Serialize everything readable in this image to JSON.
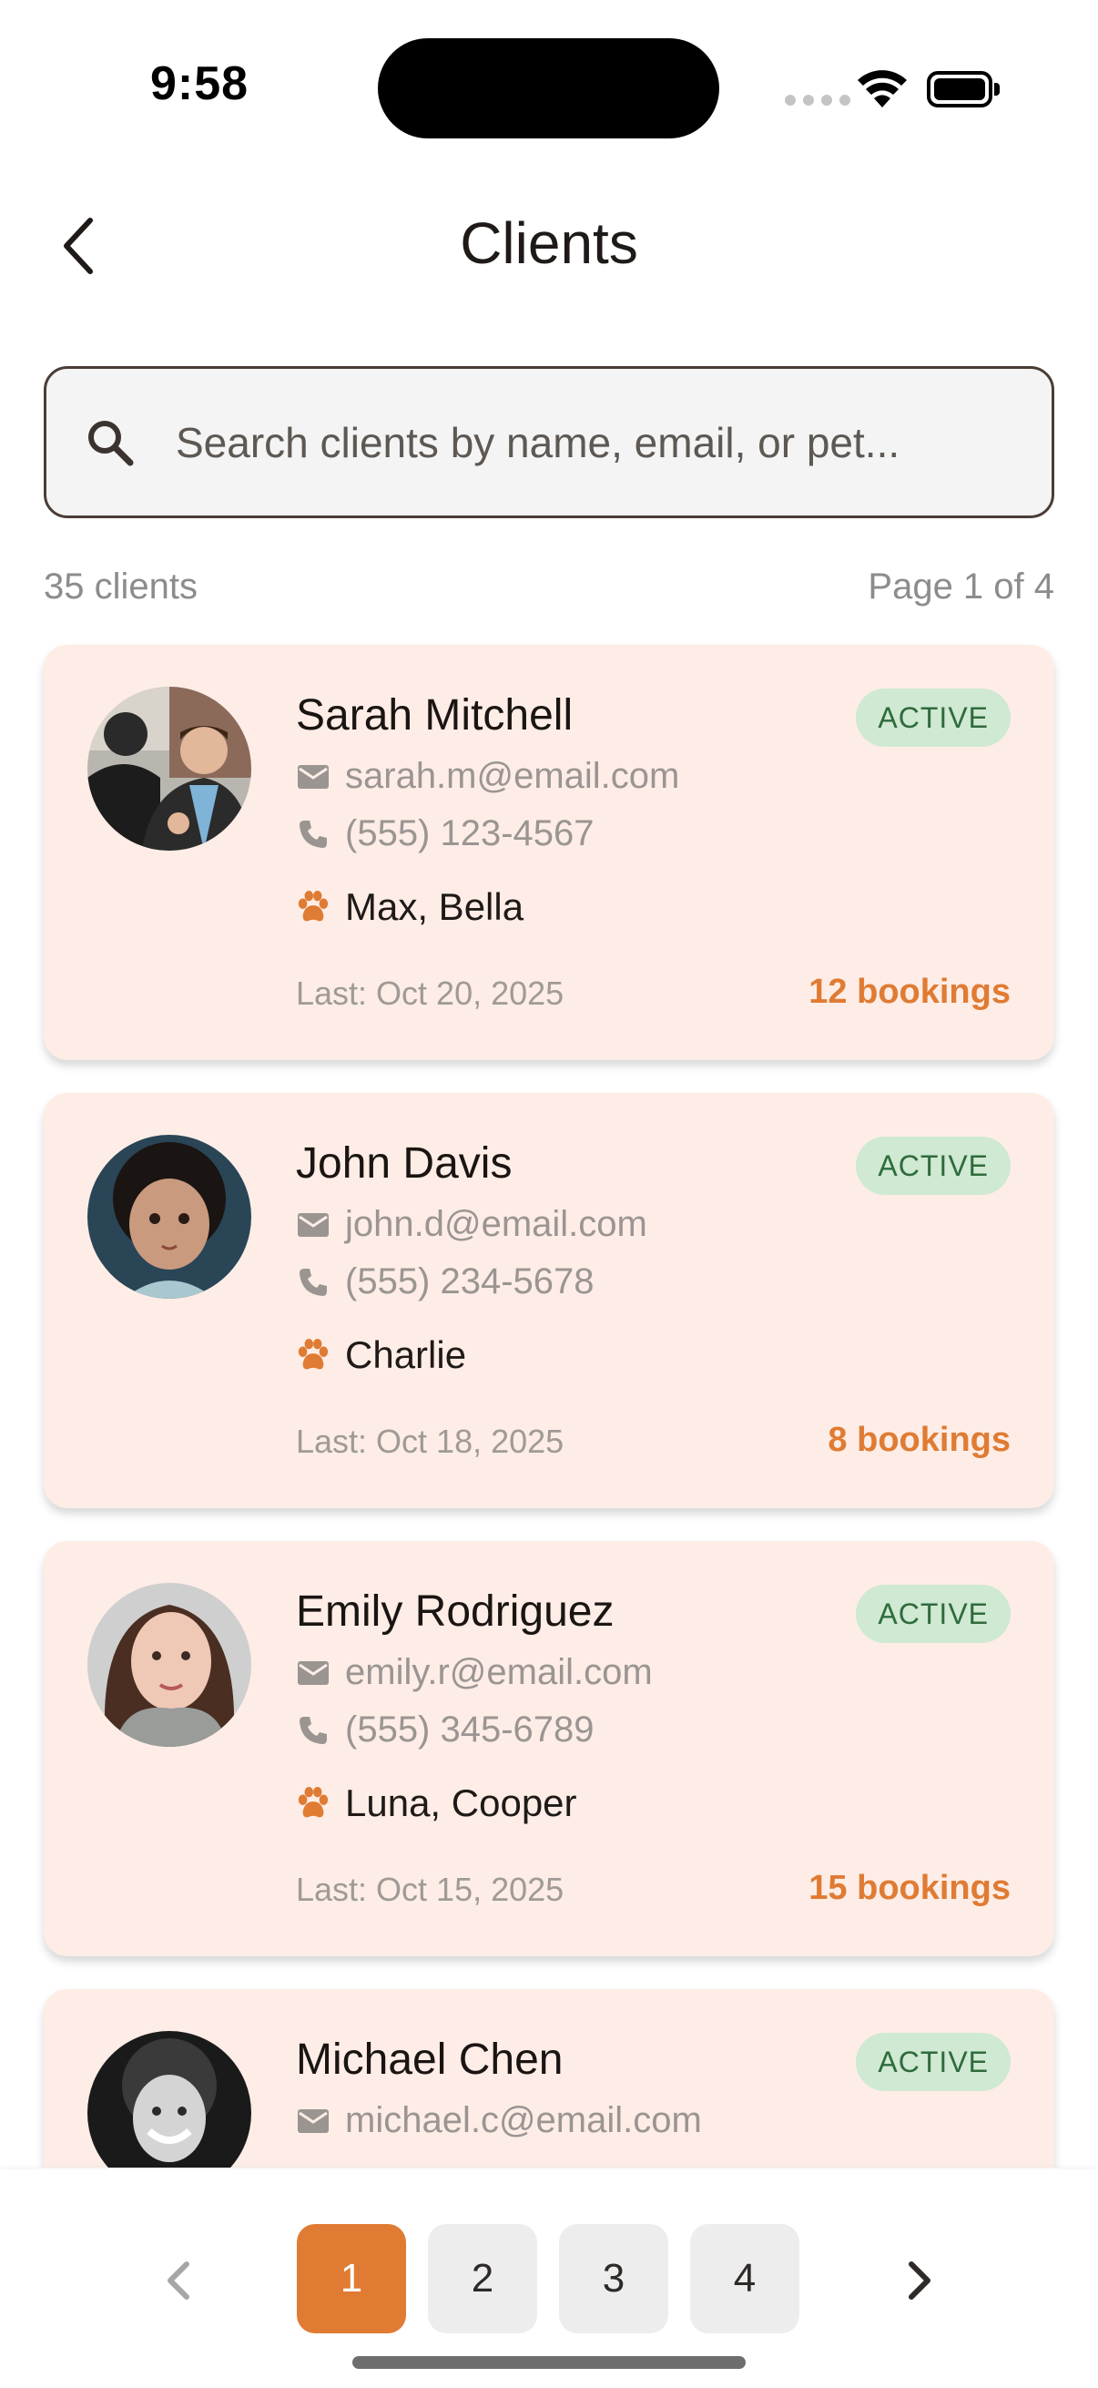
{
  "status_bar": {
    "time": "9:58"
  },
  "header": {
    "title": "Clients",
    "back_icon": "chevron-left-icon"
  },
  "search": {
    "placeholder": "Search clients by name, email, or pet...",
    "value": ""
  },
  "meta": {
    "count_text": "35 clients",
    "page_text": "Page 1 of 4"
  },
  "colors": {
    "accent": "#e07b33",
    "card_bg": "#fdede6",
    "badge_bg": "#cfe9d3",
    "badge_text": "#2f6b3c"
  },
  "clients": [
    {
      "name": "Sarah Mitchell",
      "status": "ACTIVE",
      "email": "sarah.m@email.com",
      "phone": "(555) 123-4567",
      "pets": "Max, Bella",
      "last": "Last: Oct 20, 2025",
      "bookings": "12 bookings"
    },
    {
      "name": "John Davis",
      "status": "ACTIVE",
      "email": "john.d@email.com",
      "phone": "(555) 234-5678",
      "pets": "Charlie",
      "last": "Last: Oct 18, 2025",
      "bookings": "8 bookings"
    },
    {
      "name": "Emily Rodriguez",
      "status": "ACTIVE",
      "email": "emily.r@email.com",
      "phone": "(555) 345-6789",
      "pets": "Luna, Cooper",
      "last": "Last: Oct 15, 2025",
      "bookings": "15 bookings"
    },
    {
      "name": "Michael Chen",
      "status": "ACTIVE",
      "email": "michael.c@email.com",
      "phone": "",
      "pets": "",
      "last": "",
      "bookings": ""
    }
  ],
  "pagination": {
    "pages": [
      "1",
      "2",
      "3",
      "4"
    ],
    "current": "1"
  }
}
